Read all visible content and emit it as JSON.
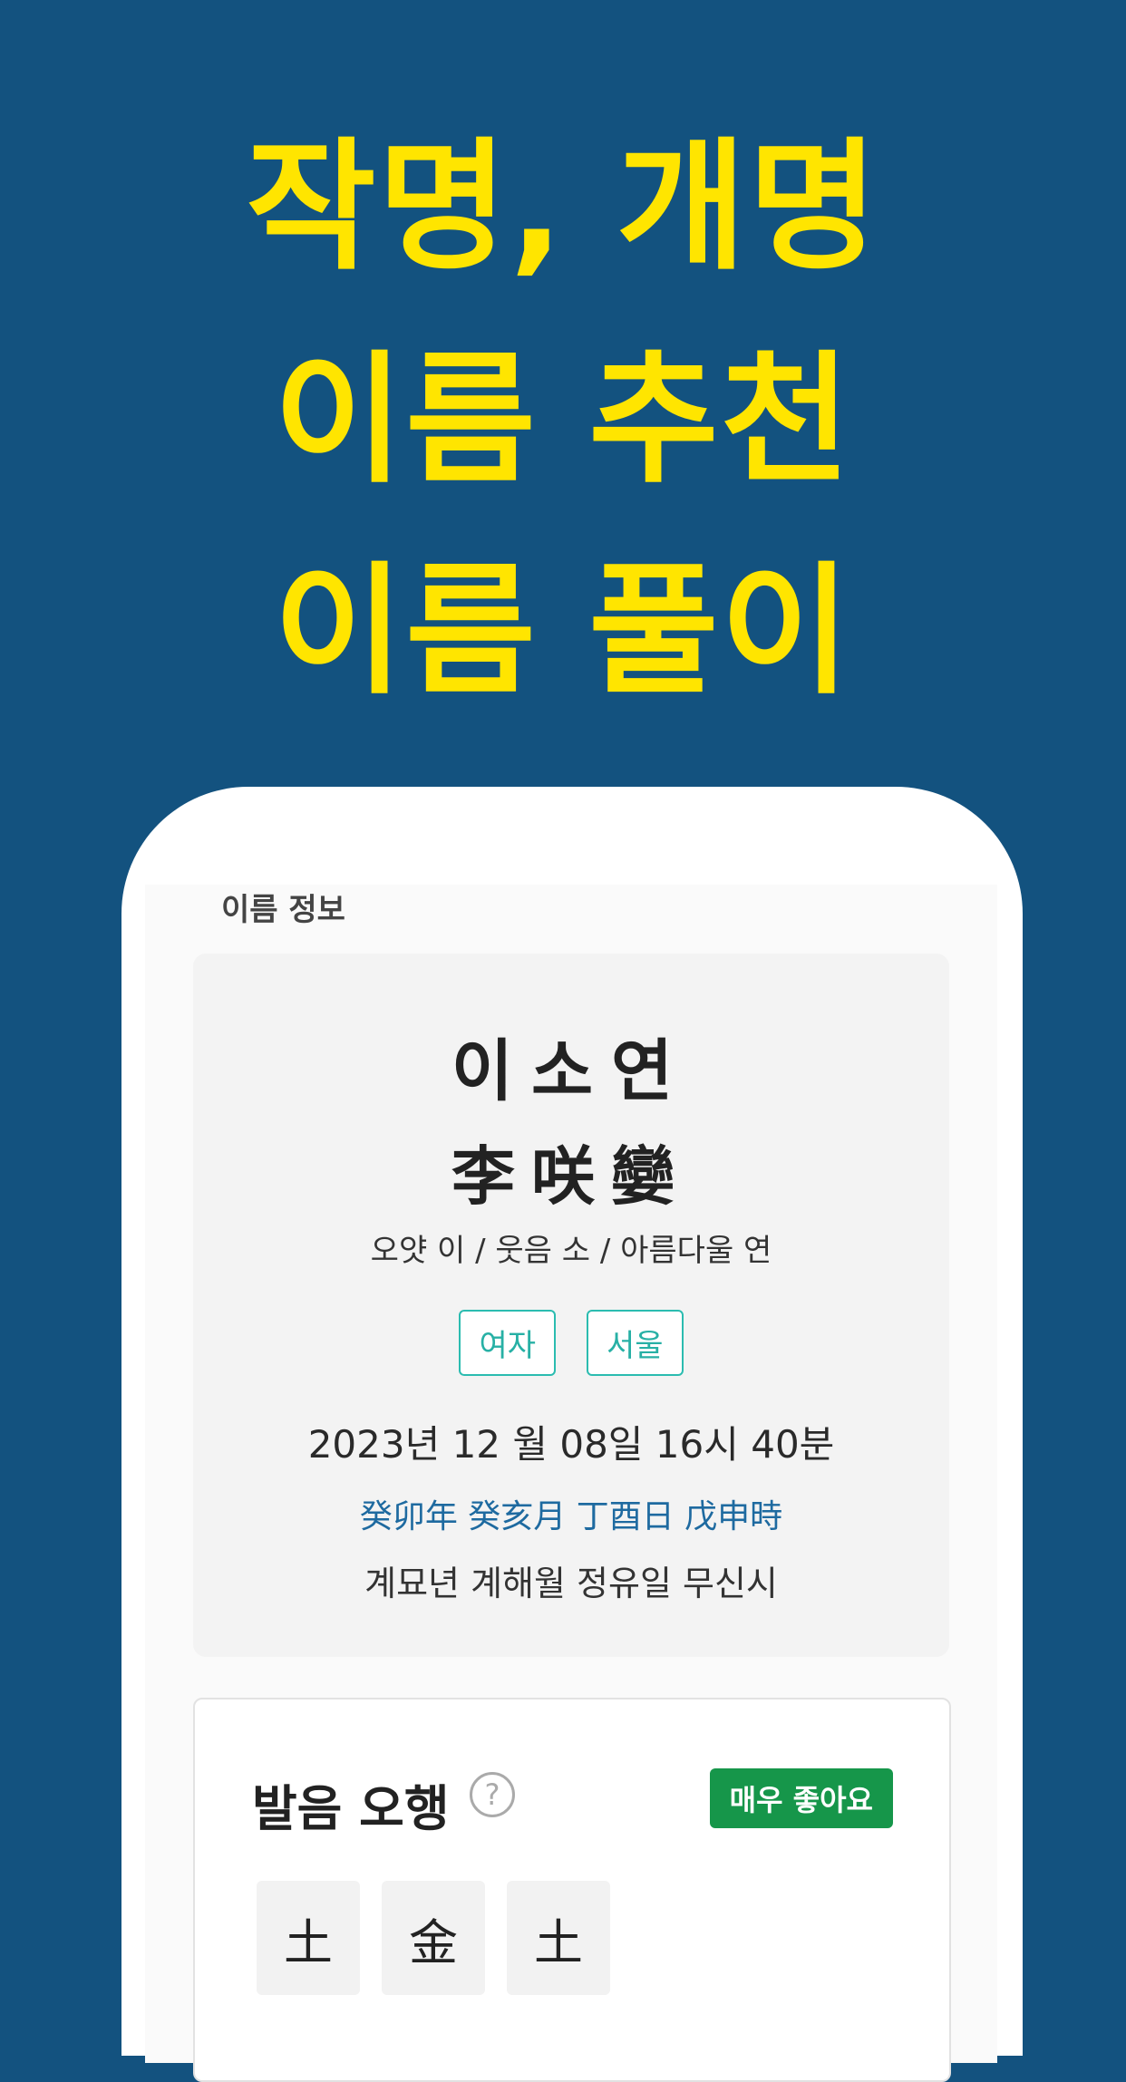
{
  "headline": {
    "line1": "작명, 개명",
    "line2": "이름 추천",
    "line3": "이름 풀이"
  },
  "name_info": {
    "section_title": "이름 정보",
    "name_korean": "이소연",
    "name_hanja": "李咲孌",
    "meaning": "오얏 이 / 웃음 소 / 아름다울 연",
    "tags": [
      "여자",
      "서울"
    ],
    "birth_datetime": "2023년 12 월 08일 16시 40분",
    "ganji_hanja": "癸卯年 癸亥月 丁酉日 戊申時",
    "ganji_korean": "계묘년 계해월 정유일 무신시"
  },
  "pronunciation": {
    "title": "발음 오행",
    "help_icon": "question-circle-icon",
    "rating": "매우 좋아요",
    "elements": [
      "土",
      "金",
      "土"
    ]
  },
  "colors": {
    "background": "#13527f",
    "headline": "#ffe500",
    "tag": "#2bbcb0",
    "ganji_hanja": "#1e6aa0",
    "badge": "#16964a"
  }
}
